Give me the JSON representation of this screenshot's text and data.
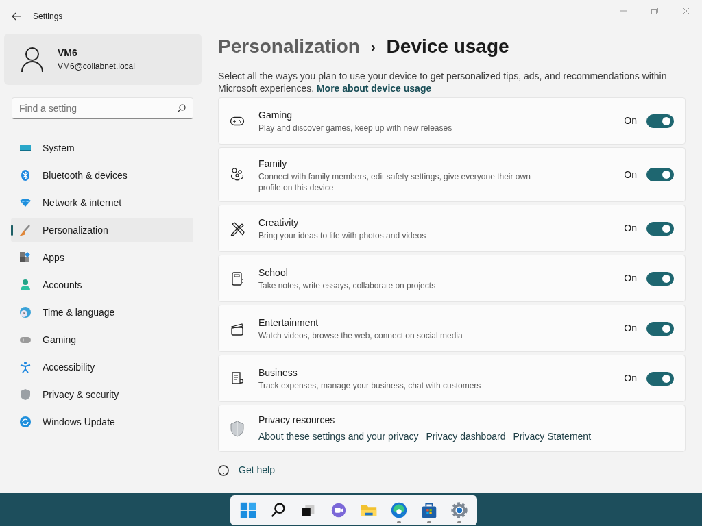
{
  "window": {
    "title": "Settings"
  },
  "account": {
    "name": "VM6",
    "email": "VM6@collabnet.local"
  },
  "search": {
    "placeholder": "Find a setting"
  },
  "sidebar": {
    "items": [
      {
        "label": "System",
        "selected": false
      },
      {
        "label": "Bluetooth & devices",
        "selected": false
      },
      {
        "label": "Network & internet",
        "selected": false
      },
      {
        "label": "Personalization",
        "selected": true
      },
      {
        "label": "Apps",
        "selected": false
      },
      {
        "label": "Accounts",
        "selected": false
      },
      {
        "label": "Time & language",
        "selected": false
      },
      {
        "label": "Gaming",
        "selected": false
      },
      {
        "label": "Accessibility",
        "selected": false
      },
      {
        "label": "Privacy & security",
        "selected": false
      },
      {
        "label": "Windows Update",
        "selected": false
      }
    ]
  },
  "breadcrumb": {
    "parent": "Personalization",
    "separator": "›",
    "current": "Device usage"
  },
  "intro": {
    "text": "Select all the ways you plan to use your device to get personalized tips, ads, and recommendations within Microsoft experiences.",
    "link": "More about device usage"
  },
  "usages": [
    {
      "title": "Gaming",
      "description": "Play and discover games, keep up with new releases",
      "state_label": "On",
      "on": true
    },
    {
      "title": "Family",
      "description": "Connect with family members, edit safety settings, give everyone their own profile on this device",
      "state_label": "On",
      "on": true
    },
    {
      "title": "Creativity",
      "description": "Bring your ideas to life with photos and videos",
      "state_label": "On",
      "on": true
    },
    {
      "title": "School",
      "description": "Take notes, write essays, collaborate on projects",
      "state_label": "On",
      "on": true
    },
    {
      "title": "Entertainment",
      "description": "Watch videos, browse the web, connect on social media",
      "state_label": "On",
      "on": true
    },
    {
      "title": "Business",
      "description": "Track expenses, manage your business, chat with customers",
      "state_label": "On",
      "on": true
    }
  ],
  "privacy": {
    "title": "Privacy resources",
    "links": [
      "About these settings and your privacy",
      "Privacy dashboard",
      "Privacy Statement"
    ]
  },
  "help": {
    "label": "Get help"
  },
  "taskbar": {
    "apps": [
      {
        "running": false
      },
      {
        "running": false
      },
      {
        "running": false
      },
      {
        "running": false
      },
      {
        "running": false
      },
      {
        "running": true
      },
      {
        "running": true
      },
      {
        "running": true
      }
    ]
  }
}
